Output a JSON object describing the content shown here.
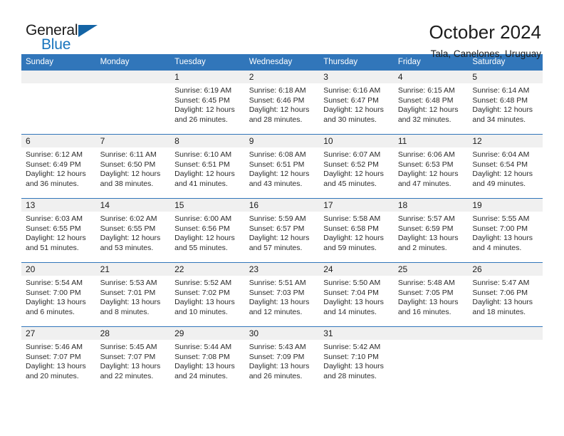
{
  "logo": {
    "text_primary": "General",
    "text_secondary": "Blue",
    "triangle_color": "#1464a5",
    "secondary_color": "#1874bd"
  },
  "header": {
    "title": "October 2024",
    "subtitle": "Tala, Canelones, Uruguay"
  },
  "theme": {
    "header_bg": "#3176ba",
    "daynum_bg": "#f0f0f0",
    "grid_line": "#3176ba",
    "text": "#1c1c1c"
  },
  "calendar": {
    "weekday_headers": [
      "Sunday",
      "Monday",
      "Tuesday",
      "Wednesday",
      "Thursday",
      "Friday",
      "Saturday"
    ],
    "weeks": [
      [
        {
          "day": "",
          "lines": []
        },
        {
          "day": "",
          "lines": []
        },
        {
          "day": "1",
          "lines": [
            "Sunrise: 6:19 AM",
            "Sunset: 6:45 PM",
            "Daylight: 12 hours",
            "and 26 minutes."
          ]
        },
        {
          "day": "2",
          "lines": [
            "Sunrise: 6:18 AM",
            "Sunset: 6:46 PM",
            "Daylight: 12 hours",
            "and 28 minutes."
          ]
        },
        {
          "day": "3",
          "lines": [
            "Sunrise: 6:16 AM",
            "Sunset: 6:47 PM",
            "Daylight: 12 hours",
            "and 30 minutes."
          ]
        },
        {
          "day": "4",
          "lines": [
            "Sunrise: 6:15 AM",
            "Sunset: 6:48 PM",
            "Daylight: 12 hours",
            "and 32 minutes."
          ]
        },
        {
          "day": "5",
          "lines": [
            "Sunrise: 6:14 AM",
            "Sunset: 6:48 PM",
            "Daylight: 12 hours",
            "and 34 minutes."
          ]
        }
      ],
      [
        {
          "day": "6",
          "lines": [
            "Sunrise: 6:12 AM",
            "Sunset: 6:49 PM",
            "Daylight: 12 hours",
            "and 36 minutes."
          ]
        },
        {
          "day": "7",
          "lines": [
            "Sunrise: 6:11 AM",
            "Sunset: 6:50 PM",
            "Daylight: 12 hours",
            "and 38 minutes."
          ]
        },
        {
          "day": "8",
          "lines": [
            "Sunrise: 6:10 AM",
            "Sunset: 6:51 PM",
            "Daylight: 12 hours",
            "and 41 minutes."
          ]
        },
        {
          "day": "9",
          "lines": [
            "Sunrise: 6:08 AM",
            "Sunset: 6:51 PM",
            "Daylight: 12 hours",
            "and 43 minutes."
          ]
        },
        {
          "day": "10",
          "lines": [
            "Sunrise: 6:07 AM",
            "Sunset: 6:52 PM",
            "Daylight: 12 hours",
            "and 45 minutes."
          ]
        },
        {
          "day": "11",
          "lines": [
            "Sunrise: 6:06 AM",
            "Sunset: 6:53 PM",
            "Daylight: 12 hours",
            "and 47 minutes."
          ]
        },
        {
          "day": "12",
          "lines": [
            "Sunrise: 6:04 AM",
            "Sunset: 6:54 PM",
            "Daylight: 12 hours",
            "and 49 minutes."
          ]
        }
      ],
      [
        {
          "day": "13",
          "lines": [
            "Sunrise: 6:03 AM",
            "Sunset: 6:55 PM",
            "Daylight: 12 hours",
            "and 51 minutes."
          ]
        },
        {
          "day": "14",
          "lines": [
            "Sunrise: 6:02 AM",
            "Sunset: 6:55 PM",
            "Daylight: 12 hours",
            "and 53 minutes."
          ]
        },
        {
          "day": "15",
          "lines": [
            "Sunrise: 6:00 AM",
            "Sunset: 6:56 PM",
            "Daylight: 12 hours",
            "and 55 minutes."
          ]
        },
        {
          "day": "16",
          "lines": [
            "Sunrise: 5:59 AM",
            "Sunset: 6:57 PM",
            "Daylight: 12 hours",
            "and 57 minutes."
          ]
        },
        {
          "day": "17",
          "lines": [
            "Sunrise: 5:58 AM",
            "Sunset: 6:58 PM",
            "Daylight: 12 hours",
            "and 59 minutes."
          ]
        },
        {
          "day": "18",
          "lines": [
            "Sunrise: 5:57 AM",
            "Sunset: 6:59 PM",
            "Daylight: 13 hours",
            "and 2 minutes."
          ]
        },
        {
          "day": "19",
          "lines": [
            "Sunrise: 5:55 AM",
            "Sunset: 7:00 PM",
            "Daylight: 13 hours",
            "and 4 minutes."
          ]
        }
      ],
      [
        {
          "day": "20",
          "lines": [
            "Sunrise: 5:54 AM",
            "Sunset: 7:00 PM",
            "Daylight: 13 hours",
            "and 6 minutes."
          ]
        },
        {
          "day": "21",
          "lines": [
            "Sunrise: 5:53 AM",
            "Sunset: 7:01 PM",
            "Daylight: 13 hours",
            "and 8 minutes."
          ]
        },
        {
          "day": "22",
          "lines": [
            "Sunrise: 5:52 AM",
            "Sunset: 7:02 PM",
            "Daylight: 13 hours",
            "and 10 minutes."
          ]
        },
        {
          "day": "23",
          "lines": [
            "Sunrise: 5:51 AM",
            "Sunset: 7:03 PM",
            "Daylight: 13 hours",
            "and 12 minutes."
          ]
        },
        {
          "day": "24",
          "lines": [
            "Sunrise: 5:50 AM",
            "Sunset: 7:04 PM",
            "Daylight: 13 hours",
            "and 14 minutes."
          ]
        },
        {
          "day": "25",
          "lines": [
            "Sunrise: 5:48 AM",
            "Sunset: 7:05 PM",
            "Daylight: 13 hours",
            "and 16 minutes."
          ]
        },
        {
          "day": "26",
          "lines": [
            "Sunrise: 5:47 AM",
            "Sunset: 7:06 PM",
            "Daylight: 13 hours",
            "and 18 minutes."
          ]
        }
      ],
      [
        {
          "day": "27",
          "lines": [
            "Sunrise: 5:46 AM",
            "Sunset: 7:07 PM",
            "Daylight: 13 hours",
            "and 20 minutes."
          ]
        },
        {
          "day": "28",
          "lines": [
            "Sunrise: 5:45 AM",
            "Sunset: 7:07 PM",
            "Daylight: 13 hours",
            "and 22 minutes."
          ]
        },
        {
          "day": "29",
          "lines": [
            "Sunrise: 5:44 AM",
            "Sunset: 7:08 PM",
            "Daylight: 13 hours",
            "and 24 minutes."
          ]
        },
        {
          "day": "30",
          "lines": [
            "Sunrise: 5:43 AM",
            "Sunset: 7:09 PM",
            "Daylight: 13 hours",
            "and 26 minutes."
          ]
        },
        {
          "day": "31",
          "lines": [
            "Sunrise: 5:42 AM",
            "Sunset: 7:10 PM",
            "Daylight: 13 hours",
            "and 28 minutes."
          ]
        },
        {
          "day": "",
          "lines": []
        },
        {
          "day": "",
          "lines": []
        }
      ]
    ]
  }
}
